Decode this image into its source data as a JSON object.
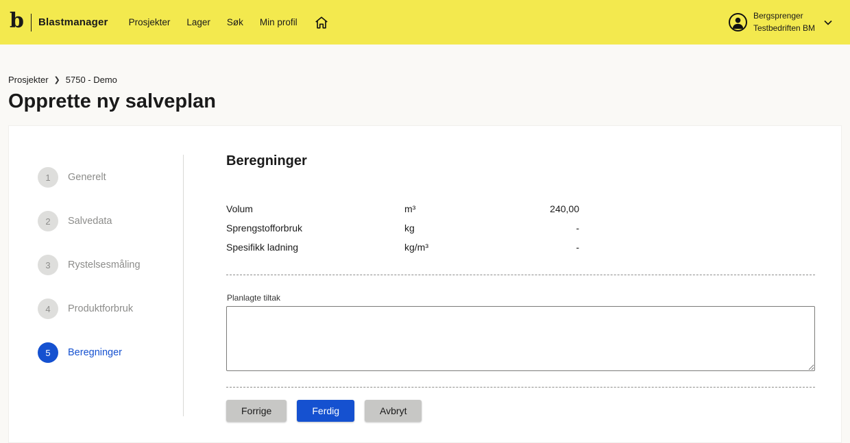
{
  "header": {
    "brand": "Blastmanager",
    "nav": [
      {
        "label": "Prosjekter"
      },
      {
        "label": "Lager"
      },
      {
        "label": "Søk"
      },
      {
        "label": "Min profil"
      }
    ],
    "user": {
      "name": "Bergsprenger",
      "company": "Testbedriften BM"
    }
  },
  "breadcrumb": {
    "items": [
      "Prosjekter",
      "5750 - Demo"
    ]
  },
  "page_title": "Opprette ny salveplan",
  "stepper": {
    "steps": [
      {
        "number": "1",
        "label": "Generelt"
      },
      {
        "number": "2",
        "label": "Salvedata"
      },
      {
        "number": "3",
        "label": "Rystelsesmåling"
      },
      {
        "number": "4",
        "label": "Produktforbruk"
      },
      {
        "number": "5",
        "label": "Beregninger"
      }
    ],
    "active_step": "5"
  },
  "content": {
    "heading": "Beregninger",
    "rows": [
      {
        "label": "Volum",
        "unit": "m³",
        "value": "240,00"
      },
      {
        "label": "Sprengstofforbruk",
        "unit": "kg",
        "value": "-"
      },
      {
        "label": "Spesifikk ladning",
        "unit": "kg/m³",
        "value": "-"
      }
    ],
    "textarea_label": "Planlagte tiltak",
    "textarea_value": "",
    "buttons": {
      "previous": "Forrige",
      "finish": "Ferdig",
      "cancel": "Avbryt"
    }
  },
  "colors": {
    "header_yellow": "#f3e94e",
    "primary_blue": "#1551d0"
  }
}
